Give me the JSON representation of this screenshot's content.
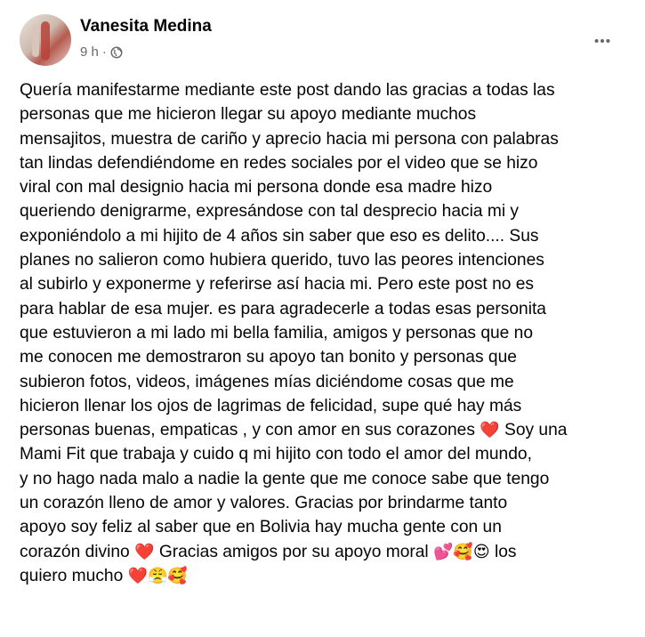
{
  "post": {
    "author": "Vanesita Medina",
    "time": "9 h",
    "separator": "·",
    "privacy_icon": "globe-icon",
    "more_icon": "more-horizontal-icon",
    "segments": [
      "Quería manifestarme mediante este post dando las gracias a todas las\npersonas que me hicieron llegar su apoyo mediante muchos\nmensajitos, muestra de cariño y aprecio hacia mi persona con palabras\ntan lindas defendiéndome en redes sociales  por el video que se hizo\nviral con mal designio hacia mi persona donde esa madre hizo\nqueriendo denigrarme, expresándose con tal desprecio hacia mi y\nexponiéndolo a mi hijito de 4 años sin saber que eso es delito.... Sus\nplanes no salieron como hubiera querido, tuvo las peores intenciones\nal subirlo y exponerme  y referirse así hacia mi. Pero este post no es\npara hablar de esa mujer. es para agradecerle a todas esas personita\nque estuvieron a mi lado mi bella familia, amigos y personas que no\nme conocen me demostraron su apoyo tan bonito y personas que\nsubieron fotos, videos, imágenes mías diciéndome cosas que me\nhicieron llenar los ojos de lagrimas de felicidad, supe qué hay más\npersonas buenas, empaticas , y con amor en sus corazones ",
      " Soy una\nMami Fit que trabaja y cuido q mi hijito con todo el amor del mundo,\ny no hago nada malo a nadie la gente que me conoce sabe que tengo\nun corazón lleno de amor y valores. Gracias por brindarme tanto\napoyo soy feliz al saber que en Bolivia hay mucha gente con un\ncorazón divino  ",
      "  Gracias amigos por su apoyo moral ",
      " los\nquiero mucho "
    ],
    "emoji_1": "❤️",
    "emoji_2": "❤️",
    "emoji_3": "💕🥰😍",
    "emoji_4": "❤️😤🥰"
  }
}
